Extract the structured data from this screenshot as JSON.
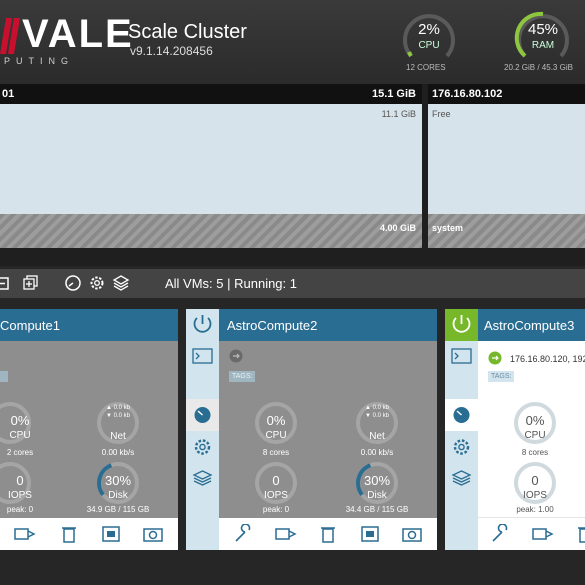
{
  "header": {
    "logo_main": "VALE",
    "logo_sub": "PUTING",
    "title": "Scale Cluster",
    "version": "v9.1.14.208456",
    "cpu": {
      "percent": "2%",
      "label": "CPU",
      "sub": "12 CORES",
      "fraction": 0.02
    },
    "ram": {
      "percent": "45%",
      "label": "RAM",
      "sub": "20.2 GiB / 45.3 GiB",
      "fraction": 0.45
    }
  },
  "storage": {
    "node1": {
      "ip_fragment": "01",
      "total": "15.1 GiB",
      "used": "11.1 GiB",
      "system": "4.00 GiB"
    },
    "node2": {
      "ip": "176.16.80.102",
      "free_label": "Free",
      "system_label": "system"
    }
  },
  "toolbar": {
    "summary": "All VMs: 5 | Running: 1"
  },
  "vms": [
    {
      "name": "Compute1",
      "cpu_value": "0%",
      "cpu_label": "CPU",
      "cpu_sub": "2 cores",
      "net_up": "▲ 0.0 kb",
      "net_down": "▼ 0.0 kb",
      "net_label": "Net",
      "net_sub": "0.00 kb/s",
      "iops_value": "0",
      "iops_label": "IOPS",
      "iops_sub": "peak: 0",
      "disk_value": "30%",
      "disk_label": "Disk",
      "disk_sub": "34.9 GB / 115 GB",
      "disk_fraction": 0.3
    },
    {
      "name": "AstroCompute2",
      "tags": "TAGS:",
      "cpu_value": "0%",
      "cpu_label": "CPU",
      "cpu_sub": "8 cores",
      "net_up": "▲ 0.0 kb",
      "net_down": "▼ 0.0 kb",
      "net_label": "Net",
      "net_sub": "0.00 kb/s",
      "iops_value": "0",
      "iops_label": "IOPS",
      "iops_sub": "peak: 0",
      "disk_value": "30%",
      "disk_label": "Disk",
      "disk_sub": "34.4 GB / 115 GB",
      "disk_fraction": 0.3
    },
    {
      "name": "AstroCompute3",
      "tags": "TAGS:",
      "ip": "176.16.80.120, 192",
      "cpu_value": "0%",
      "cpu_label": "CPU",
      "cpu_sub": "8 cores",
      "iops_value": "0",
      "iops_label": "IOPS",
      "iops_sub": "peak: 1.00"
    }
  ],
  "colors": {
    "accent": "#2a6d93",
    "running": "#76b82a",
    "gauge": "#8ec63f"
  }
}
